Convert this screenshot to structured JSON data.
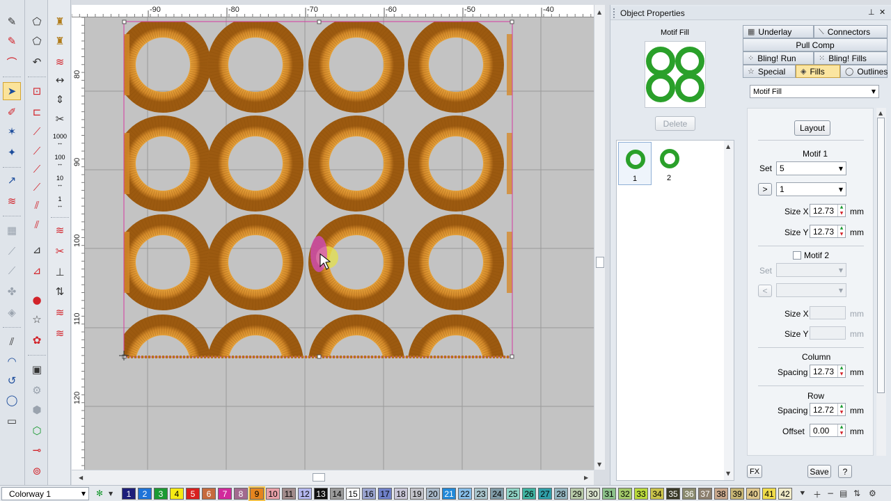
{
  "ruler": {
    "top_labels": [
      "-90",
      "-80",
      "-70",
      "-60",
      "-50",
      "-40"
    ],
    "left_labels": [
      "80",
      "90",
      "100",
      "110",
      "120"
    ]
  },
  "panel": {
    "title": "Object Properties",
    "pin_icon": "pin-icon",
    "close_icon": "close-icon",
    "preview_label": "Motif Fill",
    "delete_label": "Delete",
    "thumbs": [
      {
        "label": "1"
      },
      {
        "label": "2"
      }
    ],
    "tabs": {
      "underlay": "Underlay",
      "connectors": "Connectors",
      "pull_comp": "Pull Comp",
      "bling_run": "Bling! Run",
      "bling_fills": "Bling! Fills",
      "special": "Special",
      "fills": "Fills",
      "outlines": "Outlines"
    },
    "fill_type": "Motif Fill",
    "layout_label": "Layout",
    "motif1": {
      "heading": "Motif 1",
      "set_label": "Set",
      "set_value": "5",
      "next_label": ">",
      "item_value": "1",
      "size_x_label": "Size X",
      "size_x_value": "12.73",
      "size_y_label": "Size Y",
      "size_y_value": "12.73",
      "unit": "mm"
    },
    "motif2": {
      "heading": "Motif 2",
      "checked": false,
      "set_label": "Set",
      "prev_label": "<",
      "size_x_label": "Size X",
      "size_y_label": "Size Y",
      "unit": "mm"
    },
    "column": {
      "heading": "Column",
      "spacing_label": "Spacing",
      "spacing_value": "12.73",
      "unit": "mm"
    },
    "row": {
      "heading": "Row",
      "spacing_label": "Spacing",
      "spacing_value": "12.72",
      "offset_label": "Offset",
      "offset_value": "0.00",
      "unit": "mm"
    },
    "fx_label": "FX",
    "save_label": "Save",
    "help_label": "?"
  },
  "colorbar": {
    "colorway": "Colorway 1",
    "swatches": [
      {
        "label": "1",
        "color": "#1d1f7a",
        "fg": "#ffffff"
      },
      {
        "label": "2",
        "color": "#1e73d8",
        "fg": "#ffffff"
      },
      {
        "label": "3",
        "color": "#1a9a32",
        "fg": "#ffffff"
      },
      {
        "label": "4",
        "color": "#f5ea14",
        "fg": "#000000"
      },
      {
        "label": "5",
        "color": "#d9201e",
        "fg": "#ffffff"
      },
      {
        "label": "6",
        "color": "#c66a3c",
        "fg": "#ffffff"
      },
      {
        "label": "7",
        "color": "#d12a9c",
        "fg": "#ffffff"
      },
      {
        "label": "8",
        "color": "#a26a8f",
        "fg": "#ffffff"
      },
      {
        "label": "9",
        "color": "#e5851f",
        "fg": "#000000"
      },
      {
        "label": "10",
        "color": "#e8a0a8",
        "fg": "#000000"
      },
      {
        "label": "11",
        "color": "#a08a8a",
        "fg": "#000000"
      },
      {
        "label": "12",
        "color": "#b3b7ee",
        "fg": "#000000"
      },
      {
        "label": "13",
        "color": "#111111",
        "fg": "#ffffff"
      },
      {
        "label": "14",
        "color": "#9a9a9a",
        "fg": "#000000"
      },
      {
        "label": "15",
        "color": "#ffffff",
        "fg": "#000000"
      },
      {
        "label": "16",
        "color": "#9aa4cf",
        "fg": "#000000"
      },
      {
        "label": "17",
        "color": "#6f80c8",
        "fg": "#000000"
      },
      {
        "label": "18",
        "color": "#c9c6d8",
        "fg": "#000000"
      },
      {
        "label": "19",
        "color": "#c2c2c9",
        "fg": "#000000"
      },
      {
        "label": "20",
        "color": "#a9b9c9",
        "fg": "#000000"
      },
      {
        "label": "21",
        "color": "#2189d9",
        "fg": "#ffffff"
      },
      {
        "label": "22",
        "color": "#86bde8",
        "fg": "#000000"
      },
      {
        "label": "23",
        "color": "#a8c4cc",
        "fg": "#000000"
      },
      {
        "label": "24",
        "color": "#7f9aa6",
        "fg": "#000000"
      },
      {
        "label": "25",
        "color": "#8fd3c5",
        "fg": "#000000"
      },
      {
        "label": "26",
        "color": "#3fb2a0",
        "fg": "#000000"
      },
      {
        "label": "27",
        "color": "#2f9ea8",
        "fg": "#000000"
      },
      {
        "label": "28",
        "color": "#93b5bf",
        "fg": "#000000"
      },
      {
        "label": "29",
        "color": "#b6c9a7",
        "fg": "#000000"
      },
      {
        "label": "30",
        "color": "#d9e2cd",
        "fg": "#000000"
      },
      {
        "label": "31",
        "color": "#8cc18a",
        "fg": "#000000"
      },
      {
        "label": "32",
        "color": "#a3c96a",
        "fg": "#000000"
      },
      {
        "label": "33",
        "color": "#bada3c",
        "fg": "#000000"
      },
      {
        "label": "34",
        "color": "#c9c24a",
        "fg": "#000000"
      },
      {
        "label": "35",
        "color": "#3a3a28",
        "fg": "#ffffff"
      },
      {
        "label": "36",
        "color": "#8a8a6d",
        "fg": "#ffffff"
      },
      {
        "label": "37",
        "color": "#8c7f6e",
        "fg": "#ffffff"
      },
      {
        "label": "38",
        "color": "#c9a88c",
        "fg": "#000000"
      },
      {
        "label": "39",
        "color": "#c7b574",
        "fg": "#000000"
      },
      {
        "label": "40",
        "color": "#dfc78c",
        "fg": "#000000"
      },
      {
        "label": "41",
        "color": "#f0dc4a",
        "fg": "#000000"
      },
      {
        "label": "42",
        "color": "#f2ecc9",
        "fg": "#000000"
      }
    ]
  },
  "colors": {
    "embroidery": "#d48a2a",
    "motif_green": "#2aa02a",
    "selection": "#d63aa0"
  }
}
